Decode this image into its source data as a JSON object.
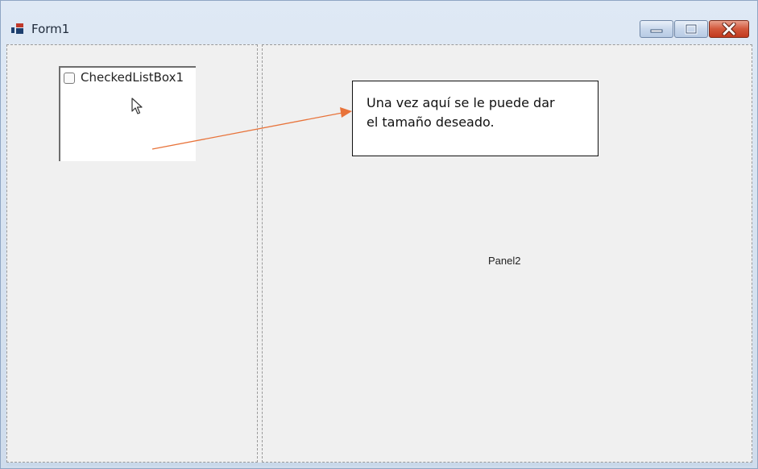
{
  "window": {
    "title": "Form1",
    "icon": "form-app-icon",
    "controls": [
      "minimize",
      "maximize",
      "close"
    ]
  },
  "panel1": {
    "checked_list_box": {
      "item_label": "CheckedListBox1",
      "checked": false
    }
  },
  "panel2": {
    "label": "Panel2"
  },
  "callout": {
    "text_line1": "Una vez aquí se le puede dar",
    "text_line2": "el tamaño deseado.",
    "arrow_color": "#e8733a"
  }
}
